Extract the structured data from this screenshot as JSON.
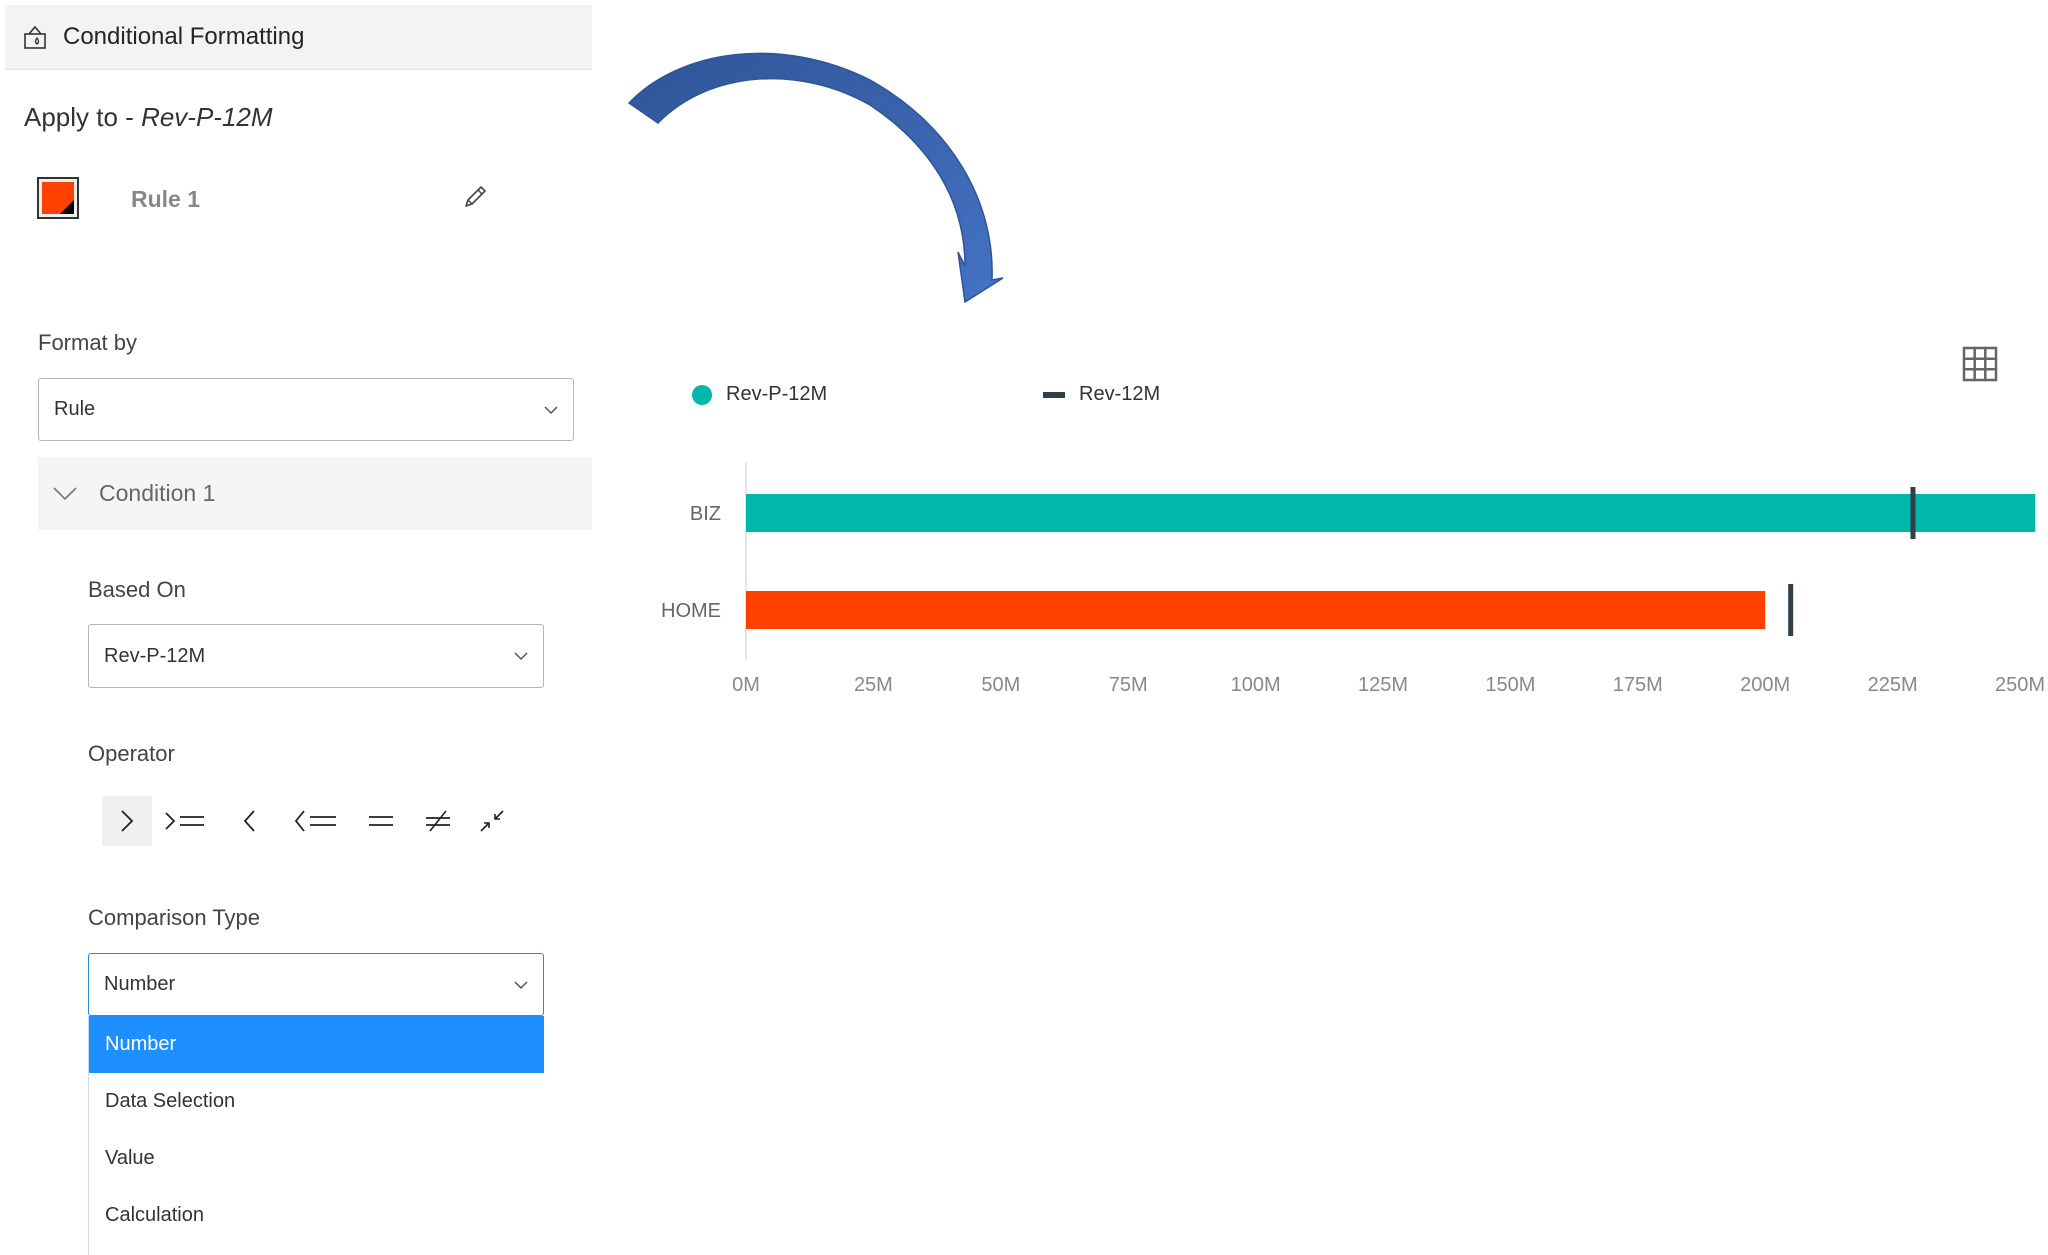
{
  "panel": {
    "header_title": "Conditional Formatting",
    "header_icon": "paint-bucket-icon",
    "apply_to_prefix": "Apply to - ",
    "apply_to_field": "Rev-P-12M",
    "rule": {
      "label": "Rule 1",
      "swatch_color": "#ff4000",
      "edit_icon": "pencil-icon"
    },
    "format_by": {
      "label": "Format by",
      "value": "Rule"
    },
    "condition": {
      "label": "Condition 1",
      "expanded": true,
      "based_on": {
        "label": "Based On",
        "value": "Rev-P-12M"
      },
      "operator": {
        "label": "Operator",
        "options": [
          ">",
          ">=",
          "<",
          "<=",
          "=",
          "≠",
          "between"
        ],
        "selected": ">"
      },
      "comparison_type": {
        "label": "Comparison Type",
        "value": "Number",
        "open": true,
        "options": [
          "Number",
          "Data Selection",
          "Value",
          "Calculation"
        ],
        "selected_index": 0
      }
    }
  },
  "annotation": {
    "arrow_color": "#4472c4"
  },
  "chart_data": {
    "type": "bar",
    "orientation": "horizontal",
    "categories": [
      "BIZ",
      "HOME"
    ],
    "series": [
      {
        "name": "Rev-P-12M",
        "marker": "circle",
        "values": [
          253,
          200
        ],
        "colors": [
          "#00b8aa",
          "#ff4000"
        ]
      },
      {
        "name": "Rev-12M",
        "marker": "target-line",
        "values": [
          229,
          205
        ],
        "color": "#333f48"
      }
    ],
    "xticks": [
      "0M",
      "25M",
      "50M",
      "75M",
      "100M",
      "125M",
      "150M",
      "175M",
      "200M",
      "225M",
      "250M"
    ],
    "xlim": [
      0,
      250
    ],
    "unit": "M",
    "title": "",
    "xlabel": "",
    "ylabel": "",
    "legend": "top-left",
    "grid": false,
    "table_view_icon": "grid-icon"
  }
}
